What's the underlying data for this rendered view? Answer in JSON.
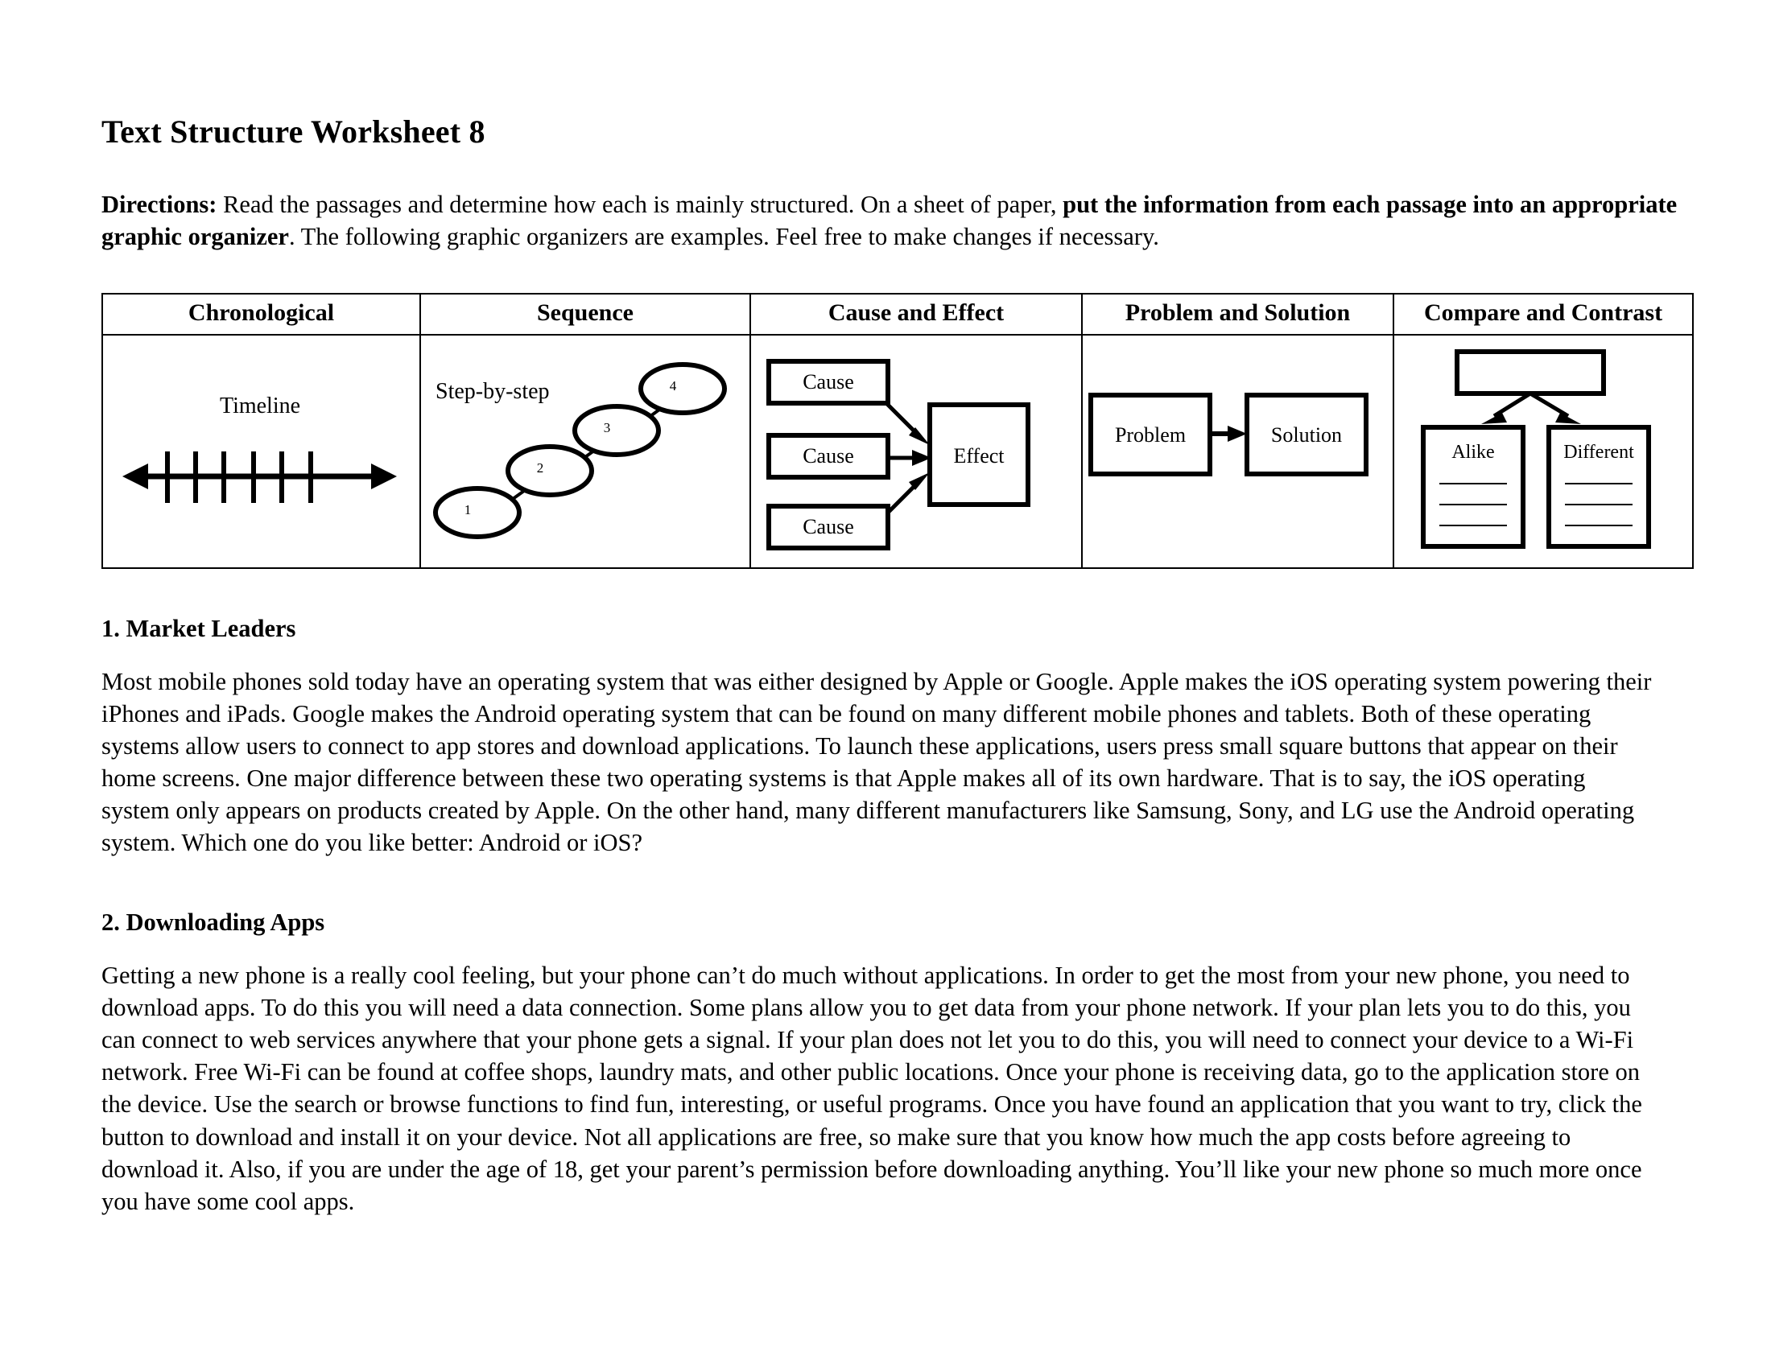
{
  "document": {
    "title": "Text Structure Worksheet 8",
    "directions": {
      "label": "Directions:",
      "part1": " Read the passages and determine how each is mainly structured. On a sheet of paper, ",
      "bold_emphasis": "put the information from each passage into an appropriate graphic organizer",
      "part2": ". The following graphic organizers are examples. Feel free to make changes if necessary."
    }
  },
  "organizer": {
    "headers": [
      "Chronological",
      "Sequence",
      "Cause and Effect",
      "Problem and Solution",
      "Compare and Contrast"
    ],
    "chronological": {
      "label": "Timeline",
      "tick_count": 6,
      "arrow_style": "double-headed"
    },
    "sequence": {
      "label": "Step-by-step",
      "steps": [
        "1",
        "2",
        "3",
        "4"
      ]
    },
    "cause_effect": {
      "causes": [
        "Cause",
        "Cause",
        "Cause"
      ],
      "effect": "Effect"
    },
    "problem_solution": {
      "problem": "Problem",
      "solution": "Solution"
    },
    "compare_contrast": {
      "top_box": "",
      "left_box": "Alike",
      "right_box": "Different",
      "blank_lines_per_box": 3
    }
  },
  "passages": [
    {
      "number_title": "1. Market Leaders",
      "body": "Most mobile phones sold today have an operating system that was either designed by Apple or Google. Apple makes the iOS operating system powering their iPhones and iPads. Google makes the Android operating system that can be found on many different mobile phones and tablets. Both of these operating systems allow users to connect to app stores and download applications. To launch these applications, users press small square buttons that appear on their home screens. One major difference between these two operating systems is that Apple makes all of its own hardware. That is to say, the iOS operating system only appears on products created by Apple. On the other hand, many different manufacturers like Samsung, Sony, and LG use the Android operating system. Which one do you like better: Android or iOS?"
    },
    {
      "number_title": "2. Downloading Apps",
      "body": "Getting a new phone is a really cool feeling, but your phone can’t do much without applications. In order to get the most from your new phone, you need to download apps. To do this you will need a data connection. Some plans allow you to get data from your phone network. If your plan lets you to do this, you can connect to web services anywhere that your phone gets a signal. If your plan does not let you to do this, you will need to connect your device to a Wi-Fi network. Free Wi-Fi can be found at coffee shops, laundry mats, and other public locations. Once your phone is receiving data, go to the application store on the device. Use the search or browse functions to find fun, interesting, or useful programs. Once you have found an application that you want to try, click the button to download and install it on your device. Not all applications are free, so make sure that you know how much the app costs before agreeing to download it.  Also, if you are under the age of 18, get your parent’s permission before downloading anything. You’ll like your new phone so much more once you have some cool apps."
    }
  ],
  "colors": {
    "ink": "#000000",
    "paper": "#ffffff"
  }
}
